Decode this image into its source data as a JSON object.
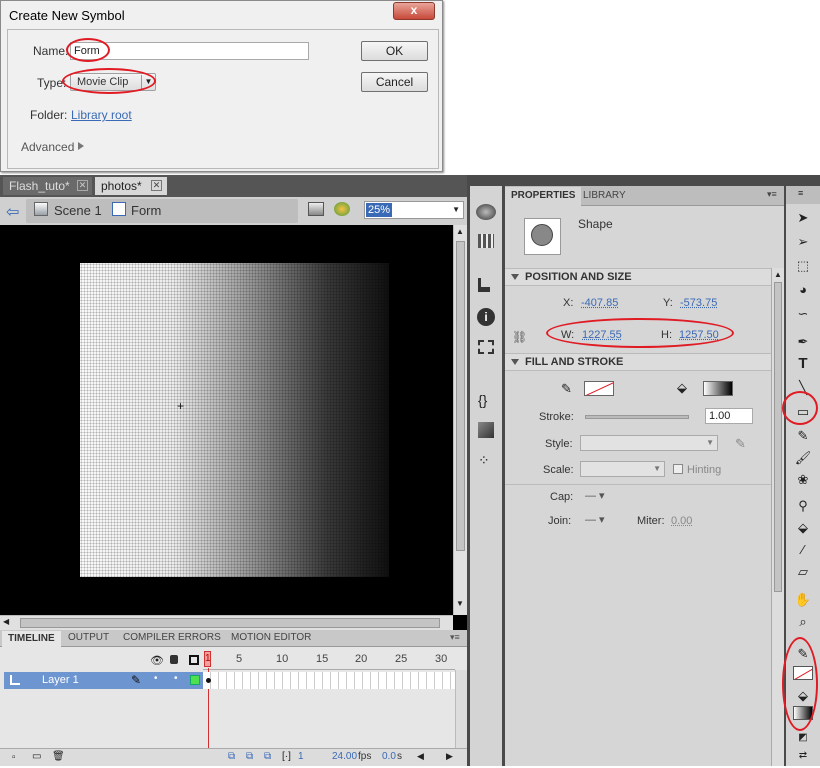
{
  "dialog": {
    "title": "Create New Symbol",
    "close": "x",
    "name_label": "Name:",
    "name_value": "Form",
    "type_label": "Type:",
    "type_value": "Movie Clip",
    "folder_label": "Folder:",
    "folder_value": "Library root",
    "advanced_label": "Advanced",
    "ok_label": "OK",
    "cancel_label": "Cancel"
  },
  "doc_tabs": [
    {
      "label": "Flash_tuto*"
    },
    {
      "label": "photos*"
    }
  ],
  "editbar": {
    "scene": "Scene 1",
    "symbol": "Form",
    "zoom": "25%"
  },
  "timeline": {
    "tabs": [
      "TIMELINE",
      "OUTPUT",
      "COMPILER ERRORS",
      "MOTION EDITOR"
    ],
    "frame_numbers": [
      "1",
      "5",
      "10",
      "15",
      "20",
      "25",
      "30"
    ],
    "layer_name": "Layer 1",
    "status": {
      "frame": "1",
      "fps": "24.00",
      "fps_unit": "fps",
      "time": "0.0",
      "time_unit": "s"
    }
  },
  "properties": {
    "tabs": [
      "PROPERTIES",
      "LIBRARY"
    ],
    "object_type": "Shape",
    "position_header": "POSITION AND SIZE",
    "x_label": "X:",
    "x_value": "-407.85",
    "y_label": "Y:",
    "y_value": "-573.75",
    "w_label": "W:",
    "w_value": "1227.55",
    "h_label": "H:",
    "h_value": "1257.50",
    "fill_header": "FILL AND STROKE",
    "stroke_label": "Stroke:",
    "stroke_value": "1.00",
    "style_label": "Style:",
    "scale_label": "Scale:",
    "hinting_label": "Hinting",
    "cap_label": "Cap:",
    "join_label": "Join:",
    "miter_label": "Miter:",
    "miter_value": "0.00"
  },
  "colors": {
    "annotation": "#e01b24",
    "accent": "#3a6ab5",
    "layer_highlight": "#6d95d0"
  }
}
